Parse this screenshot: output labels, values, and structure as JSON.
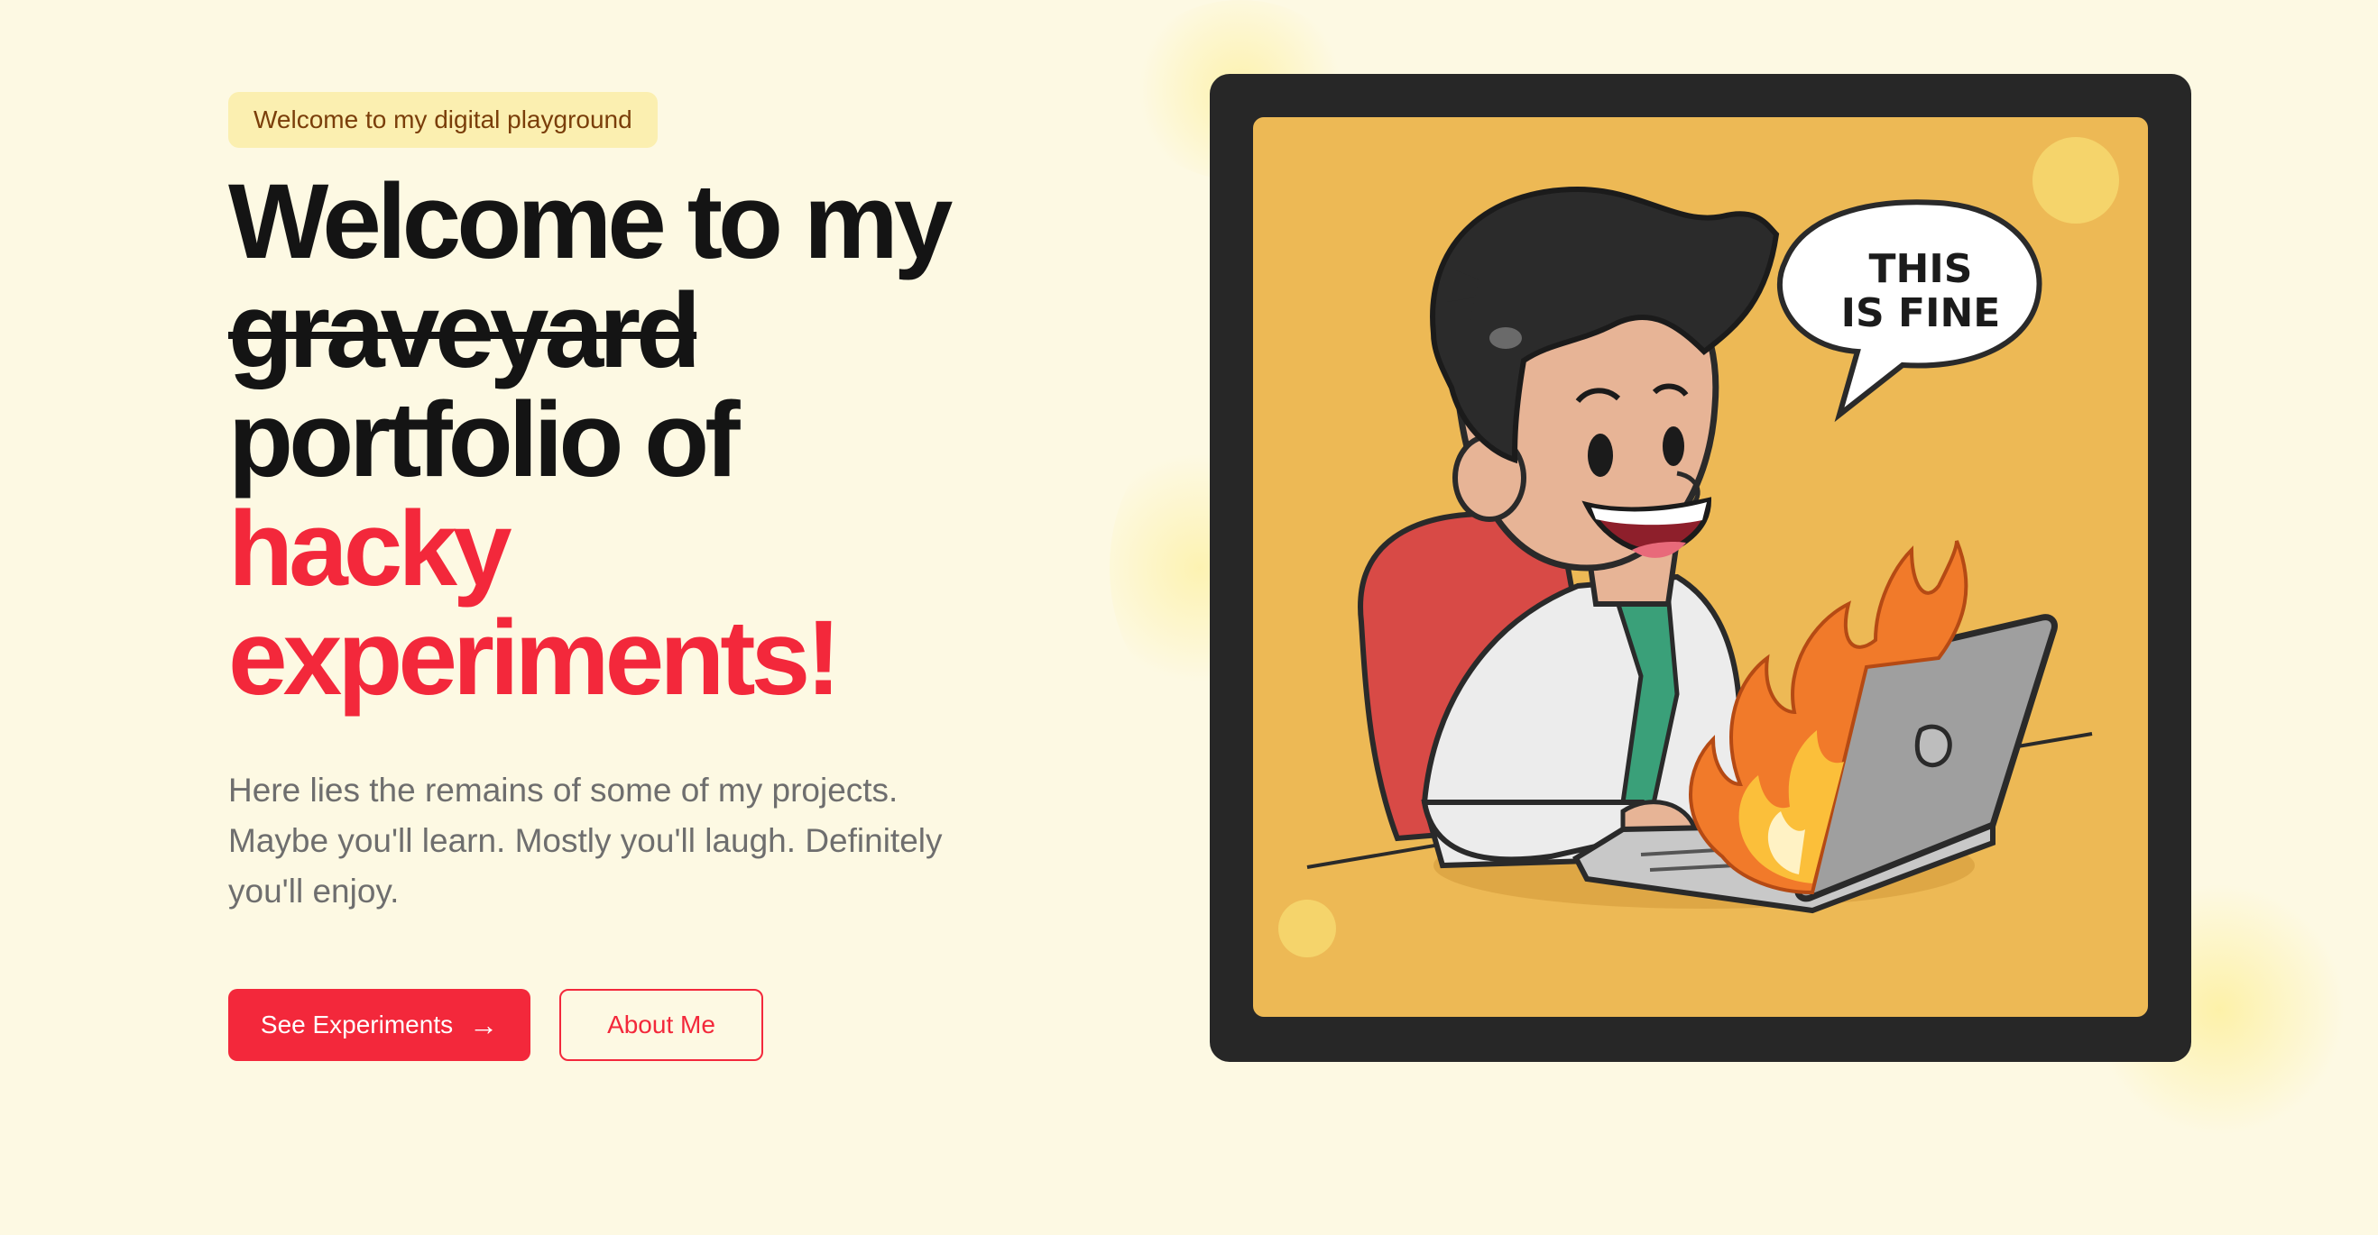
{
  "hero": {
    "badge": "Welcome to my digital playground",
    "headline": {
      "line1": "Welcome to my",
      "struck": "graveyard",
      "line3": "portfolio of",
      "accent1": "hacky",
      "accent2": "experiments!"
    },
    "description": "Here lies the remains of some of my projects. Maybe you'll learn. Mostly you'll laugh. Definitely you'll enjoy.",
    "primary_button": "See Experiments",
    "secondary_button": "About Me"
  },
  "illustration": {
    "speech_line1": "THIS",
    "speech_line2": "IS FINE"
  },
  "colors": {
    "background": "#fdf9e3",
    "accent": "#f3283b",
    "badge_bg": "#fbefb0",
    "frame": "#272727",
    "art_bg": "#edb955"
  },
  "icons": {
    "button_arrow": "arrow-right-icon"
  }
}
